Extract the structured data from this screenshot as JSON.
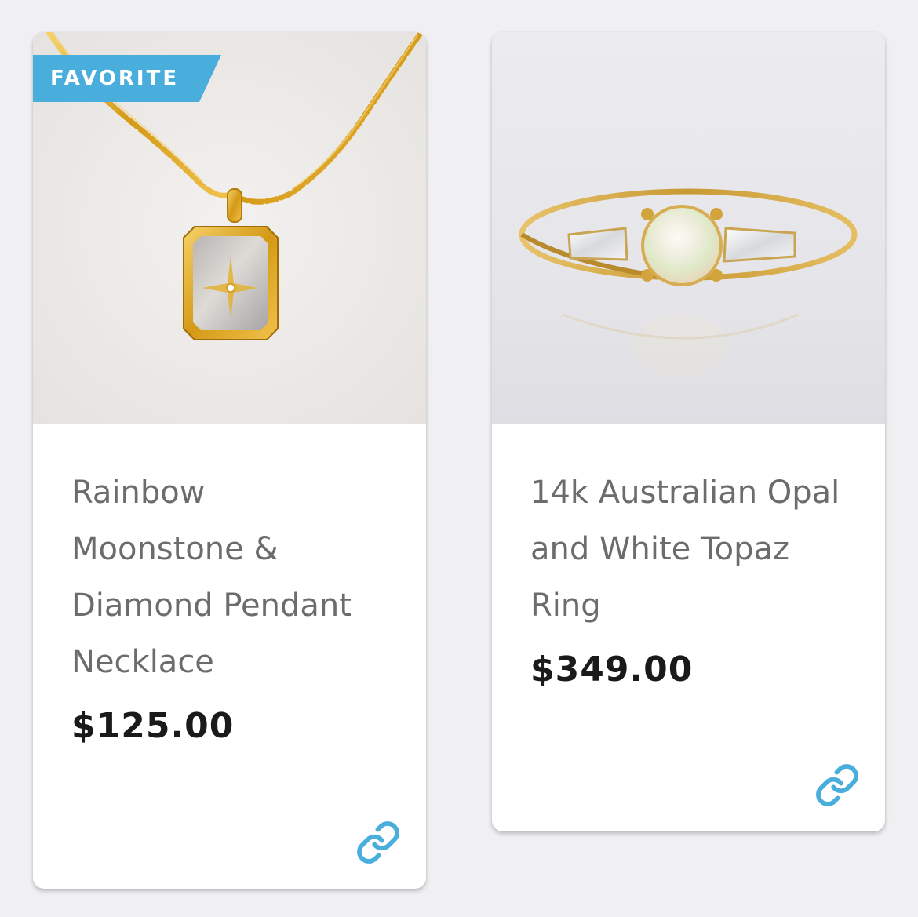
{
  "products": [
    {
      "badge": "FAVORITE",
      "title": "Rainbow Moonstone & Diamond Pendant Necklace",
      "price": "$125.00",
      "image_icon": "necklace-photo",
      "link_icon": "link-icon"
    },
    {
      "title": "14k Australian Opal and White Topaz Ring",
      "price": "$349.00",
      "image_icon": "ring-photo",
      "link_icon": "link-icon"
    }
  ],
  "colors": {
    "badge": "#4aaedd",
    "link_icon": "#4aaedd",
    "title_text": "#6c6c6c",
    "price_text": "#1a1a1a",
    "background": "#f0f0f2"
  }
}
